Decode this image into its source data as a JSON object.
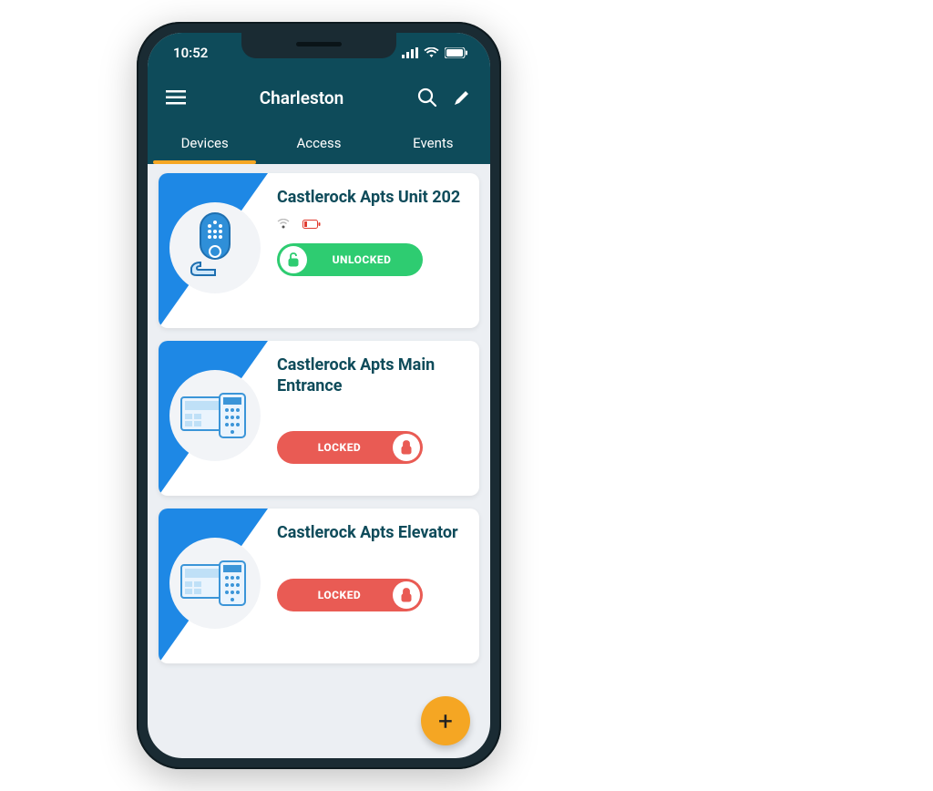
{
  "status_bar": {
    "time": "10:52"
  },
  "header": {
    "title": "Charleston"
  },
  "tabs": [
    {
      "label": "Devices",
      "active": true
    },
    {
      "label": "Access",
      "active": false
    },
    {
      "label": "Events",
      "active": false
    }
  ],
  "devices": [
    {
      "name": "Castlerock Apts Unit 202",
      "icon": "smart-lock",
      "show_wifi": true,
      "show_battery_low": true,
      "state": "UNLOCKED",
      "state_color": "green"
    },
    {
      "name": "Castlerock Apts Main Entrance",
      "icon": "access-panel",
      "show_wifi": false,
      "show_battery_low": false,
      "state": "LOCKED",
      "state_color": "red"
    },
    {
      "name": "Castlerock Apts Elevator",
      "icon": "access-panel",
      "show_wifi": false,
      "show_battery_low": false,
      "state": "LOCKED",
      "state_color": "red"
    }
  ],
  "fab": {
    "label": "+"
  }
}
